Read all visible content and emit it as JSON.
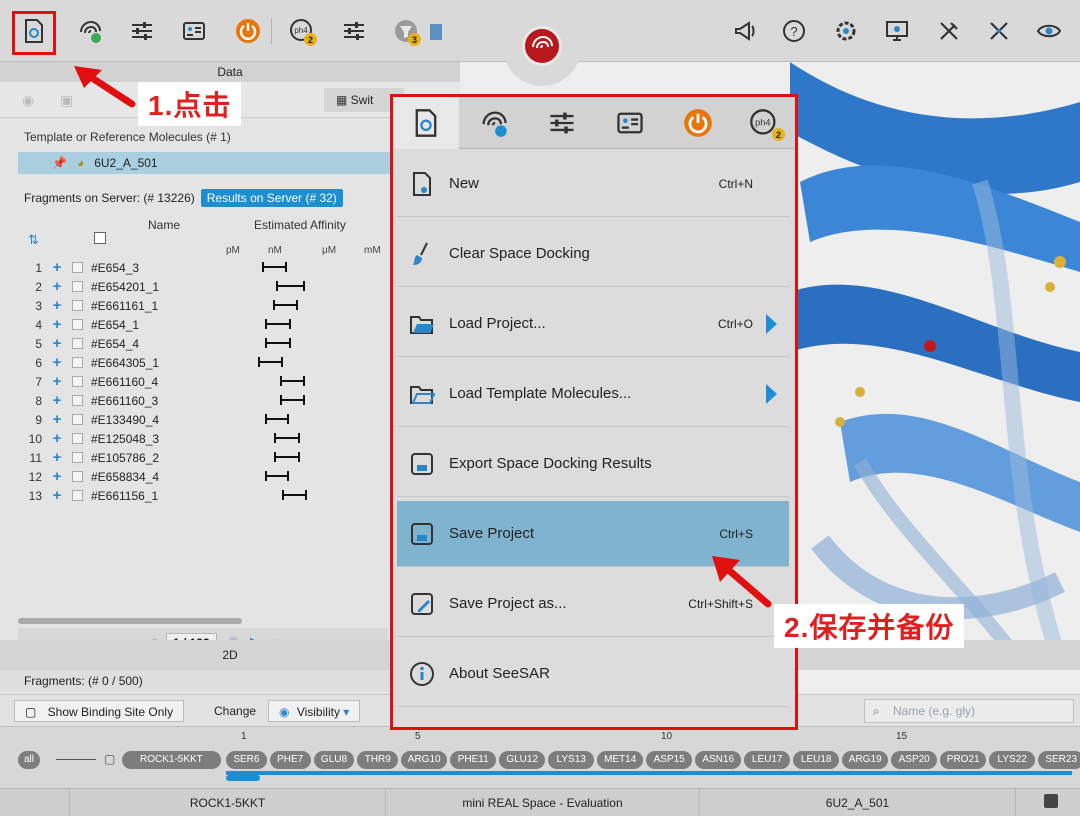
{
  "toolbar": {
    "left_icons": [
      "file-menu-icon",
      "binding-site-icon",
      "sliders-icon",
      "id-card-icon",
      "power-icon",
      "pharmacophore-icon",
      "filter-sliders-icon",
      "filter-icon"
    ],
    "badges": {
      "pharmacophore": "2",
      "filter": "3"
    },
    "right_icons": [
      "announce-icon",
      "help-icon",
      "settings-icon",
      "monitor-icon",
      "tools-icon",
      "cross-tools-icon",
      "eye-icon"
    ]
  },
  "data_panel": {
    "header": "Data",
    "switch_label": "Swit",
    "template_title": "Template or Reference Molecules (# 1)",
    "template_item": "6U2_A_501",
    "fragments_server": "Fragments on Server: (# 13226)",
    "results_server": "Results on Server (# 32)",
    "col_name": "Name",
    "col_affinity": "Estimated Affinity",
    "units": [
      "pM",
      "nM",
      "μM",
      "mM"
    ],
    "rows": [
      {
        "idx": "1",
        "name": "#E654_3",
        "lo": 0.56,
        "hi": 0.7
      },
      {
        "idx": "2",
        "name": "#E654201_1",
        "lo": 0.64,
        "hi": 0.8
      },
      {
        "idx": "3",
        "name": "#E661161_1",
        "lo": 0.62,
        "hi": 0.76
      },
      {
        "idx": "4",
        "name": "#E654_1",
        "lo": 0.58,
        "hi": 0.72
      },
      {
        "idx": "5",
        "name": "#E654_4",
        "lo": 0.58,
        "hi": 0.72
      },
      {
        "idx": "6",
        "name": "#E664305_1",
        "lo": 0.54,
        "hi": 0.68
      },
      {
        "idx": "7",
        "name": "#E661160_4",
        "lo": 0.66,
        "hi": 0.8
      },
      {
        "idx": "8",
        "name": "#E661160_3",
        "lo": 0.66,
        "hi": 0.8
      },
      {
        "idx": "9",
        "name": "#E133490_4",
        "lo": 0.58,
        "hi": 0.71
      },
      {
        "idx": "10",
        "name": "#E125048_3",
        "lo": 0.63,
        "hi": 0.77
      },
      {
        "idx": "11",
        "name": "#E105786_2",
        "lo": 0.63,
        "hi": 0.77
      },
      {
        "idx": "12",
        "name": "#E658834_4",
        "lo": 0.58,
        "hi": 0.71
      },
      {
        "idx": "13",
        "name": "#E661156_1",
        "lo": 0.67,
        "hi": 0.81
      }
    ],
    "page": "1 / 133",
    "fragments_bottom": "Fragments: (# 0 / 500)",
    "view_2d": "2D"
  },
  "menu": {
    "items": [
      {
        "label": "New",
        "shortcut": "Ctrl+N",
        "icon": "new-file-icon",
        "arrow": false
      },
      {
        "label": "Clear Space Docking",
        "shortcut": "",
        "icon": "brush-icon",
        "arrow": false
      },
      {
        "label": "Load Project...",
        "shortcut": "Ctrl+O",
        "icon": "open-folder-icon",
        "arrow": true
      },
      {
        "label": "Load Template Molecules...",
        "shortcut": "",
        "icon": "template-folder-icon",
        "arrow": true
      },
      {
        "label": "Export Space Docking Results",
        "shortcut": "",
        "icon": "export-save-icon",
        "arrow": false
      },
      {
        "label": "Save Project",
        "shortcut": "Ctrl+S",
        "icon": "save-icon",
        "arrow": false
      },
      {
        "label": "Save Project as...",
        "shortcut": "Ctrl+Shift+S",
        "icon": "save-as-icon",
        "arrow": false
      },
      {
        "label": "About SeeSAR",
        "shortcut": "",
        "icon": "info-icon",
        "arrow": false
      }
    ],
    "badge": "2"
  },
  "filter_bar": {
    "show_binding": "Show Binding Site Only",
    "change": "Change",
    "visibility": "Visibility",
    "search_placeholder": "Name (e.g. gly)"
  },
  "sequence": {
    "all": "all",
    "chain": "ROCK1-5KKT",
    "numbers": [
      "1",
      "5",
      "10",
      "15"
    ],
    "residues": [
      "SER6",
      "PHE7",
      "GLU8",
      "THR9",
      "ARG10",
      "PHE11",
      "GLU12",
      "LYS13",
      "MET14",
      "ASP15",
      "ASN16",
      "LEU17",
      "LEU18",
      "ARG19",
      "ASP20",
      "PRO21",
      "LYS22",
      "SER23"
    ]
  },
  "status": {
    "protein": "ROCK1-5KKT",
    "space": "mini REAL Space - Evaluation",
    "ligand": "6U2_A_501"
  },
  "annotations": {
    "step1": "1.点击",
    "step2": "2.保存并备份"
  },
  "colors": {
    "accent": "#1d8fd0",
    "highlight": "#7fb3cf",
    "annotation": "#e01010",
    "power": "#e8760f"
  }
}
